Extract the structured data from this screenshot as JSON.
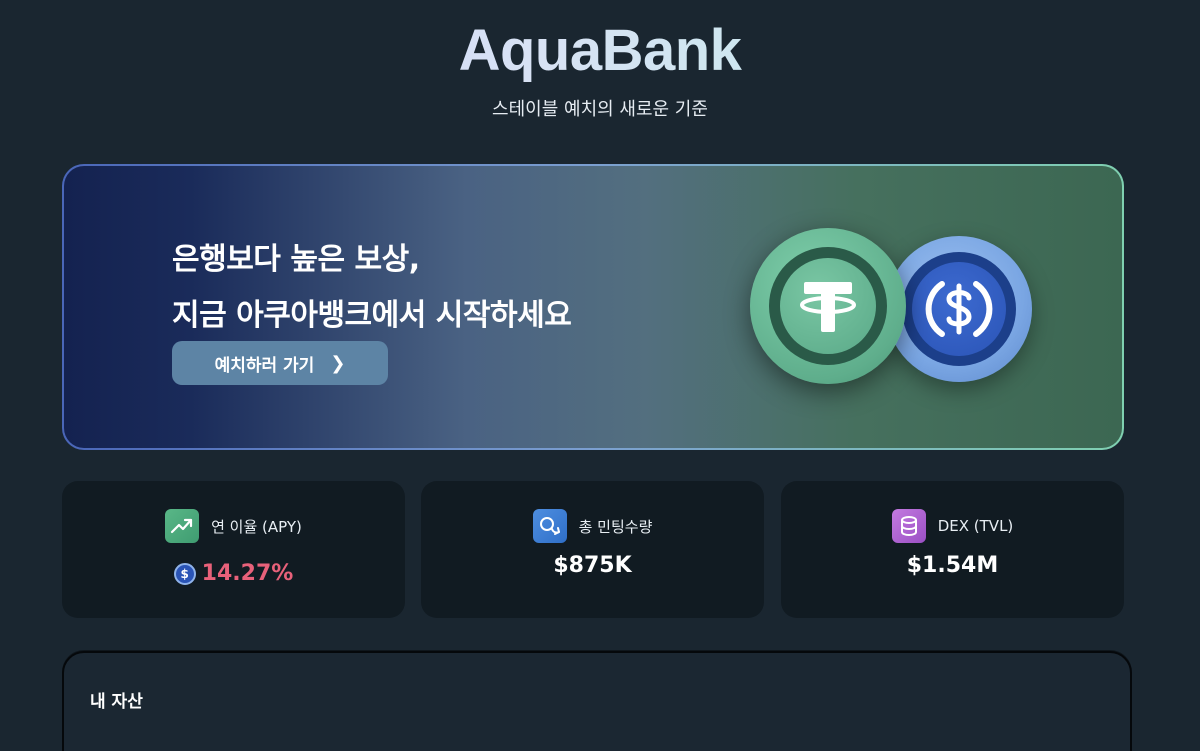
{
  "header": {
    "logo": "AquaBank",
    "tagline": "스테이블 예치의 새로운 기준"
  },
  "hero": {
    "line1": "은행보다 높은 보상,",
    "line2": "지금 아쿠아뱅크에서 시작하세요",
    "cta_label": "예치하러 가기",
    "cta_chevron": "❯",
    "coins": [
      "tether-icon",
      "usdc-icon"
    ]
  },
  "stats": [
    {
      "icon": "trending-up-icon",
      "label": "연 이율 (APY)",
      "value": "14.27%",
      "value_color": "#e8617a"
    },
    {
      "icon": "minting-icon",
      "label": "총 민팅수량",
      "value": "$875K"
    },
    {
      "icon": "database-icon",
      "label": "DEX (TVL)",
      "value": "$1.54M"
    }
  ],
  "assets": {
    "title": "내 자산"
  },
  "colors": {
    "background": "#1a2630",
    "card": "#111b22",
    "accent_green": "#5fae8c",
    "accent_blue": "#2a54b6",
    "apy_red": "#e8617a"
  }
}
